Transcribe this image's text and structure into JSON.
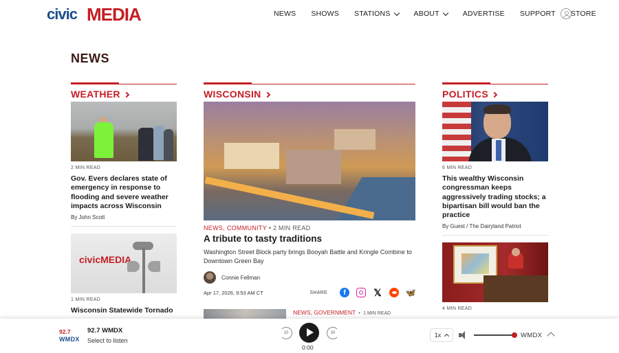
{
  "brand": {
    "logo_text_civ": "civic",
    "logo_text_media": "MEDIA",
    "accent": "#c41e24",
    "secondary": "#1b4f8a"
  },
  "nav": {
    "items": [
      {
        "label": "NEWS"
      },
      {
        "label": "SHOWS"
      },
      {
        "label": "STATIONS"
      },
      {
        "label": "ABOUT"
      },
      {
        "label": "ADVERTISE"
      },
      {
        "label": "SUPPORT"
      },
      {
        "label": "STORE"
      }
    ]
  },
  "page": {
    "title": "NEWS"
  },
  "weather": {
    "section": "WEATHER",
    "articles": [
      {
        "read_time": "2 MIN READ",
        "headline": "Gov. Evers declares state of emergency in response to flooding and severe weather impacts across Wisconsin",
        "byline": "By John Scott"
      },
      {
        "read_time": "1 MIN READ",
        "headline": "Wisconsin Statewide Tornado",
        "logo_text": "civicMEDIA"
      }
    ]
  },
  "wisconsin": {
    "section": "WISCONSIN",
    "featured": {
      "tags": [
        "NEWS,",
        "COMMUNITY"
      ],
      "read_time": "2 MIN READ",
      "headline": "A tribute to tasty traditions",
      "dek": "Washington Street Block party brings Booyah Battle and Kringle Combine to Downtown Green Bay",
      "author": "Connie Fellman",
      "date": "Apr 17, 2026, 9:53 AM CT",
      "share_label": "SHARE"
    },
    "second": {
      "tags": [
        "NEWS,",
        "GOVERNMENT"
      ],
      "read_time": "1 MIN READ"
    }
  },
  "politics": {
    "section": "POLITICS",
    "articles": [
      {
        "read_time": "6 MIN READ",
        "headline": "This wealthy Wisconsin congressman keeps aggressively trading stocks; a bipartisan bill would ban the practice",
        "byline": "By Guest / The Dairyland Patriot"
      },
      {
        "read_time": "4 MIN READ"
      }
    ]
  },
  "player": {
    "station_freq": "92.7",
    "station_call": "WMDX",
    "station_name": "92.7 WMDX",
    "subtitle": "Select to listen",
    "skip_back_label": "10",
    "skip_fwd_label": "30",
    "time": "0:00",
    "speed": "1x",
    "volume_label": "WMDX"
  }
}
